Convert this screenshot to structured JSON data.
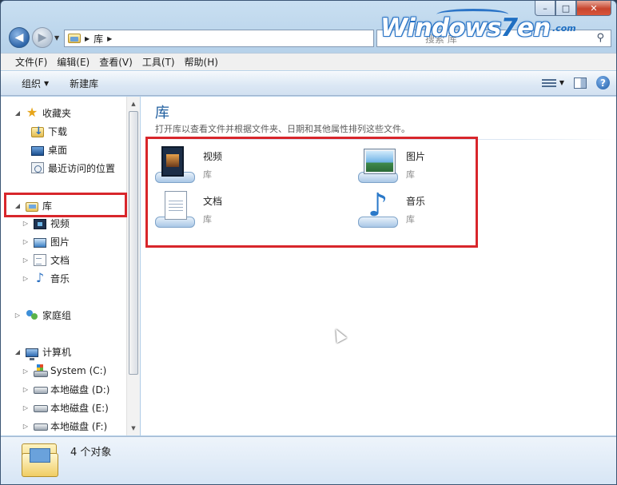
{
  "window": {
    "caption": {
      "minimize": "–",
      "maximize": "□",
      "close": "✕"
    }
  },
  "address": {
    "segments": [
      "库"
    ],
    "search_placeholder": "搜索 库"
  },
  "watermark": {
    "text_a": "Windows",
    "seven": "7",
    "text_b": "en",
    "domain": ".com"
  },
  "menu": [
    "文件(F)",
    "编辑(E)",
    "查看(V)",
    "工具(T)",
    "帮助(H)"
  ],
  "toolbar": {
    "organize": "组织",
    "new_library": "新建库"
  },
  "nav": {
    "favorites": {
      "label": "收藏夹",
      "items": [
        "下载",
        "桌面",
        "最近访问的位置"
      ]
    },
    "libraries": {
      "label": "库",
      "items": [
        "视频",
        "图片",
        "文档",
        "音乐"
      ]
    },
    "homegroup": {
      "label": "家庭组"
    },
    "computer": {
      "label": "计算机",
      "items": [
        "System (C:)",
        "本地磁盘 (D:)",
        "本地磁盘 (E:)",
        "本地磁盘 (F:)"
      ]
    }
  },
  "content": {
    "title": "库",
    "subtitle": "打开库以查看文件并根据文件夹、日期和其他属性排列这些文件。",
    "libraries": [
      {
        "name": "视频",
        "type": "库",
        "icon": "video-library-icon"
      },
      {
        "name": "图片",
        "type": "库",
        "icon": "pictures-library-icon"
      },
      {
        "name": "文档",
        "type": "库",
        "icon": "documents-library-icon"
      },
      {
        "name": "音乐",
        "type": "库",
        "icon": "music-library-icon"
      }
    ]
  },
  "details": {
    "count": "4 个对象"
  },
  "colors": {
    "highlight": "#d8262b",
    "title_blue": "#1f5e9f"
  }
}
